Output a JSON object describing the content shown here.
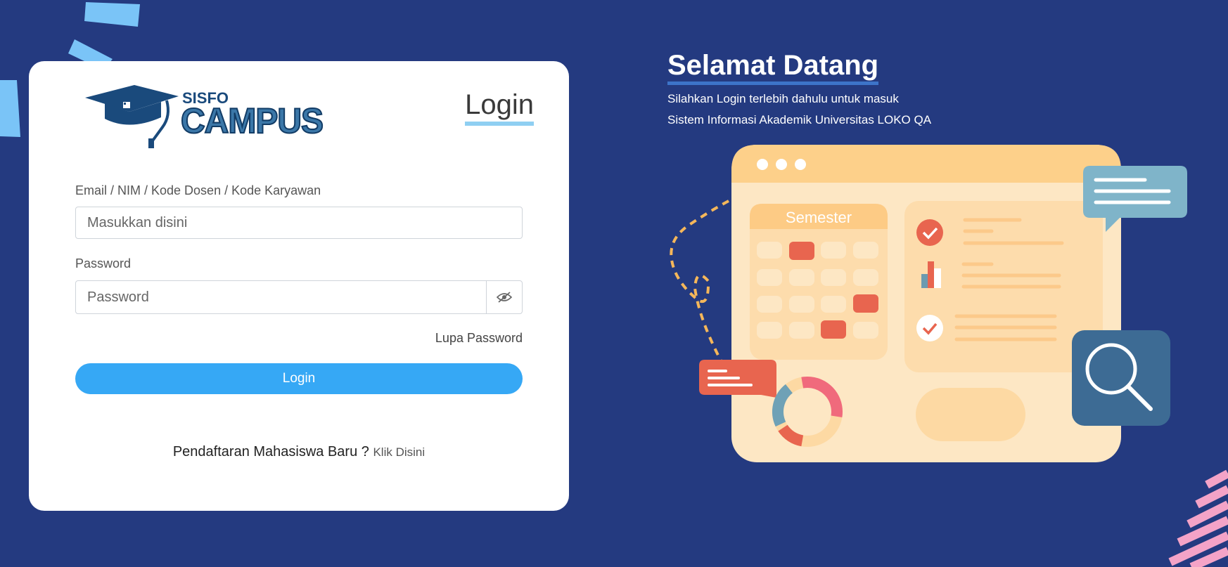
{
  "card": {
    "title": "Login",
    "logo": {
      "line1": "SISFO",
      "line2": "CAMPUS"
    },
    "identifier_field": {
      "label": "Email / NIM / Kode Dosen / Kode Karyawan",
      "placeholder": "Masukkan disini",
      "value": ""
    },
    "password_field": {
      "label": "Password",
      "placeholder": "Password",
      "value": ""
    },
    "forgot_password": "Lupa Password",
    "login_button": "Login",
    "register_prompt": "Pendaftaran Mahasiswa Baru ?",
    "register_link": "Klik Disini"
  },
  "welcome": {
    "title": "Selamat Datang",
    "line1": "Silahkan Login terlebih dahulu untuk masuk",
    "line2": "Sistem Informasi Akademik Universitas LOKO QA"
  },
  "illustration": {
    "semester_label": "Semester"
  },
  "icons": [
    "graduation-cap-icon",
    "eye-slash-icon",
    "check-icon",
    "bar-chart-icon",
    "magnifier-icon",
    "chat-bubble-icon",
    "donut-chart-icon"
  ],
  "colors": {
    "background": "#243a80",
    "primary_button": "#36a8f5",
    "title_underline": "#8fcff2"
  }
}
